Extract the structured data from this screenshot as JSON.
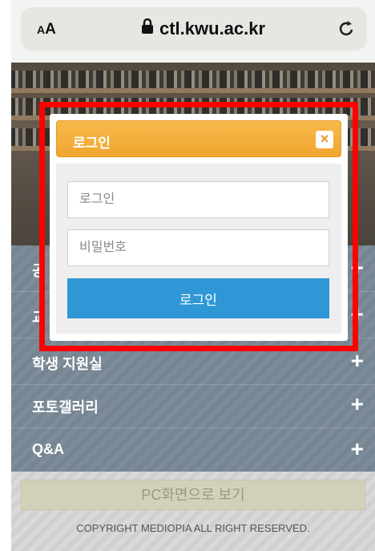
{
  "browser": {
    "aa_label_small": "A",
    "aa_label_large": "A",
    "url": "ctl.kwu.ac.kr",
    "lock_icon": "lock-icon",
    "reload_icon": "reload-icon"
  },
  "menu": {
    "items": [
      {
        "label": "공",
        "icon": "plus-icon"
      },
      {
        "label": "교",
        "icon": "plus-icon"
      },
      {
        "label": "학생 지원실",
        "icon": "plus-icon"
      },
      {
        "label": "포토갤러리",
        "icon": "plus-icon"
      },
      {
        "label": "Q&A",
        "icon": "plus-icon"
      }
    ]
  },
  "footer": {
    "pc_view_label": "PC화면으로 보기",
    "copyright": "COPYRIGHT MEDIOPIA ALL RIGHT RESERVED."
  },
  "modal": {
    "title": "로그인",
    "close_glyph": "×",
    "id_placeholder": "로그인",
    "password_placeholder": "비밀번호",
    "submit_label": "로그인"
  },
  "colors": {
    "modal_header": "#f1a630",
    "login_button": "#2f97d6",
    "highlight_border": "#ff0000"
  }
}
